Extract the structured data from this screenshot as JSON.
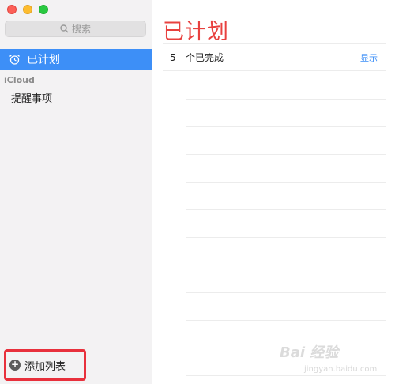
{
  "sidebar": {
    "search_placeholder": "搜索",
    "selected_item_label": "已计划",
    "section_header": "iCloud",
    "lists": [
      {
        "label": "提醒事项"
      }
    ],
    "add_list_label": "添加列表",
    "add_list_highlight_color": "#e8303c",
    "selection_color": "#3d8ff7"
  },
  "main": {
    "title": "已计划",
    "title_color": "#e8413f",
    "completed_count": "5",
    "completed_label": "个已完成",
    "show_label": "显示"
  },
  "watermark": {
    "brand": "Bai 经验",
    "url": "jingyan.baidu.com"
  }
}
